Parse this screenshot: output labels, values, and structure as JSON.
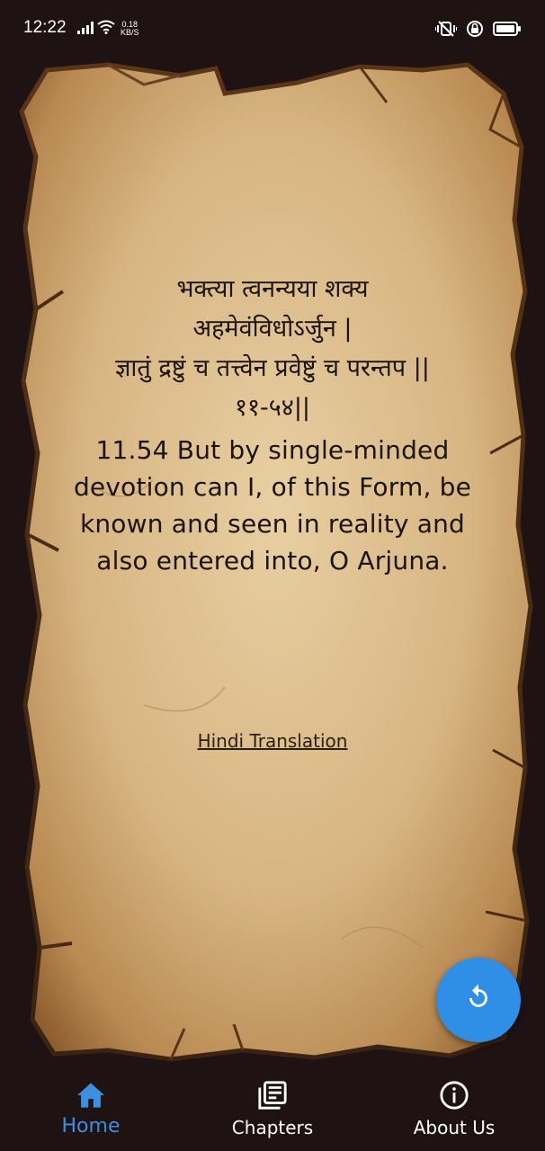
{
  "status": {
    "time": "12:22",
    "net_speed_value": "0.18",
    "net_speed_unit": "KB/S"
  },
  "verse": {
    "sanskrit": "भक्त्या त्वनन्यया शक्य\nअहमेवंविधोऽर्जुन |\nज्ञातुं द्रष्टुं च तत्त्वेन प्रवेष्टुं च परन्तप ||\n११-५४||",
    "english": "11.54 But by single-minded devotion can I, of this Form, be known and seen in reality and also entered into, O Arjuna."
  },
  "hindi_link": "Hindi Translation",
  "fab": {
    "icon": "refresh-icon",
    "color": "#2f8fe6"
  },
  "nav": {
    "items": [
      {
        "label": "Home",
        "icon": "home-icon",
        "active": true
      },
      {
        "label": "Chapters",
        "icon": "chapters-icon",
        "active": false
      },
      {
        "label": "About Us",
        "icon": "info-icon",
        "active": false
      }
    ],
    "active_color": "#3b8ee0"
  },
  "colors": {
    "background": "#1e1213",
    "parchment": "#d9b98a",
    "text": "#1b1411"
  }
}
